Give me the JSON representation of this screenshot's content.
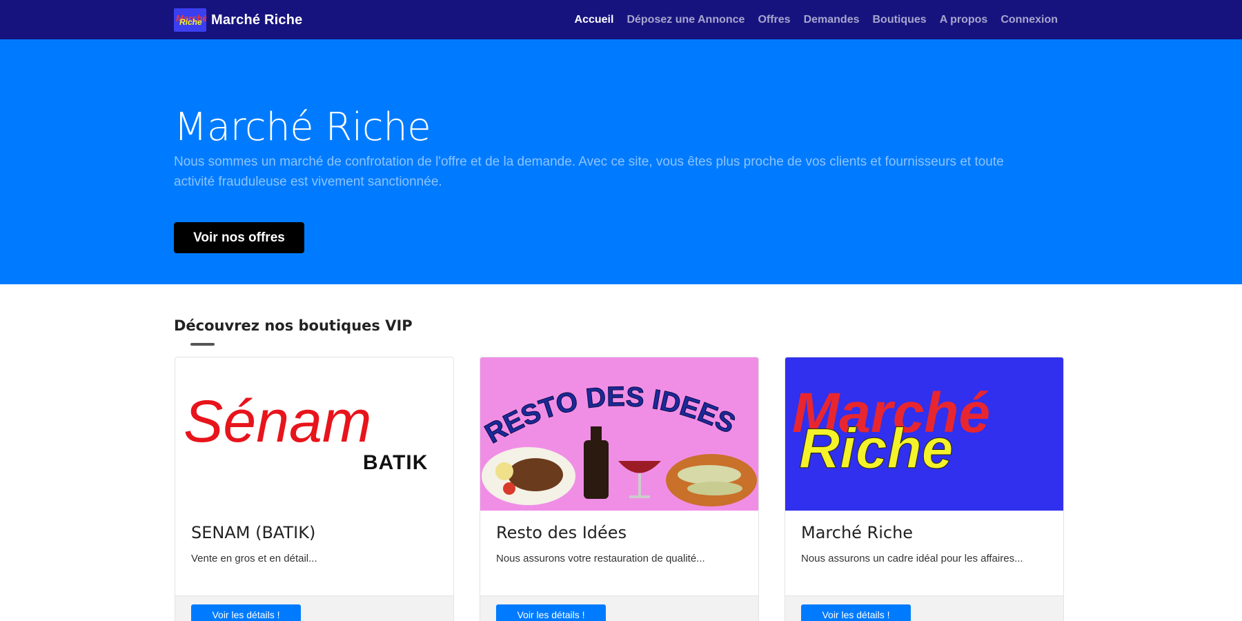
{
  "navbar": {
    "brand": "Marché Riche",
    "logo_text": {
      "line1": "Marché",
      "line2": "Riche"
    },
    "links": [
      "Accueil",
      "Déposez une Annonce",
      "Offres",
      "Demandes",
      "Boutiques",
      "A propos",
      "Connexion"
    ],
    "active_link": "Accueil"
  },
  "hero": {
    "title": "Marché Riche",
    "text": "Nous sommes un marché de confrotation de l'offre et de la demande. Avec ce site, vous êtes plus proche de vos clients et fournisseurs et toute activité frauduleuse est vivement sanctionnée.",
    "button": "Voir nos offres"
  },
  "section": {
    "title": "Découvrez nos boutiques VIP"
  },
  "cards": [
    {
      "title": "SENAM (BATIK)",
      "text": "Vente en gros et en détail...",
      "button": "Voir les détails !",
      "logo": {
        "main": "Sénam",
        "sub": "BATIK"
      }
    },
    {
      "title": "Resto des Idées",
      "text": "Nous assurons votre restauration de qualité...",
      "button": "Voir les détails !",
      "logo": {
        "main": "RESTO DES IDEES"
      }
    },
    {
      "title": "Marché Riche",
      "text": "Nous assurons un cadre idéal pour les affaires...",
      "button": "Voir les détails !",
      "logo": {
        "line1": "Marché",
        "line2": "Riche"
      }
    }
  ],
  "colors": {
    "navbar": "#17137e",
    "hero": "#007bff",
    "primary_button": "#007bff",
    "dark_button": "#000000"
  }
}
